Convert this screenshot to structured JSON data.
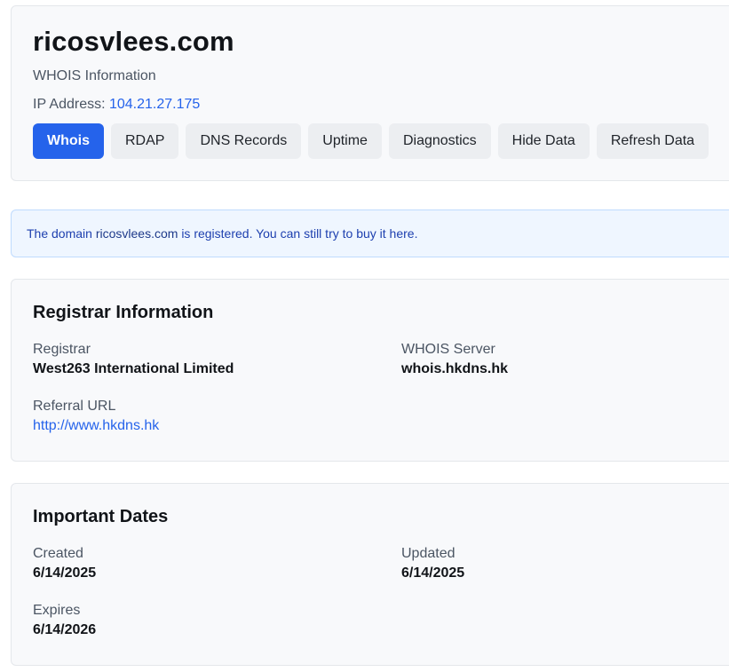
{
  "header": {
    "domain": "ricosvlees.com",
    "subtitle": "WHOIS Information",
    "ip_label": "IP Address:",
    "ip_value": "104.21.27.175",
    "tabs": [
      {
        "label": "Whois",
        "active": true
      },
      {
        "label": "RDAP",
        "active": false
      },
      {
        "label": "DNS Records",
        "active": false
      },
      {
        "label": "Uptime",
        "active": false
      },
      {
        "label": "Diagnostics",
        "active": false
      },
      {
        "label": "Hide Data",
        "active": false
      },
      {
        "label": "Refresh Data",
        "active": false
      }
    ]
  },
  "notice": {
    "prefix": "The domain",
    "domain": "ricosvlees.com",
    "middle": "is registered. You can still try to buy it",
    "link_text": "here",
    "suffix": "."
  },
  "registrar": {
    "title": "Registrar Information",
    "registrar_label": "Registrar",
    "registrar_value": "West263 International Limited",
    "whois_server_label": "WHOIS Server",
    "whois_server_value": "whois.hkdns.hk",
    "referral_label": "Referral URL",
    "referral_value": "http://www.hkdns.hk"
  },
  "dates": {
    "title": "Important Dates",
    "created_label": "Created",
    "created_value": "6/14/2025",
    "updated_label": "Updated",
    "updated_value": "6/14/2025",
    "expires_label": "Expires",
    "expires_value": "6/14/2026"
  },
  "colors": {
    "accent": "#2563eb",
    "notice_bg": "#eff6ff",
    "card_bg": "#f8f9fb"
  }
}
